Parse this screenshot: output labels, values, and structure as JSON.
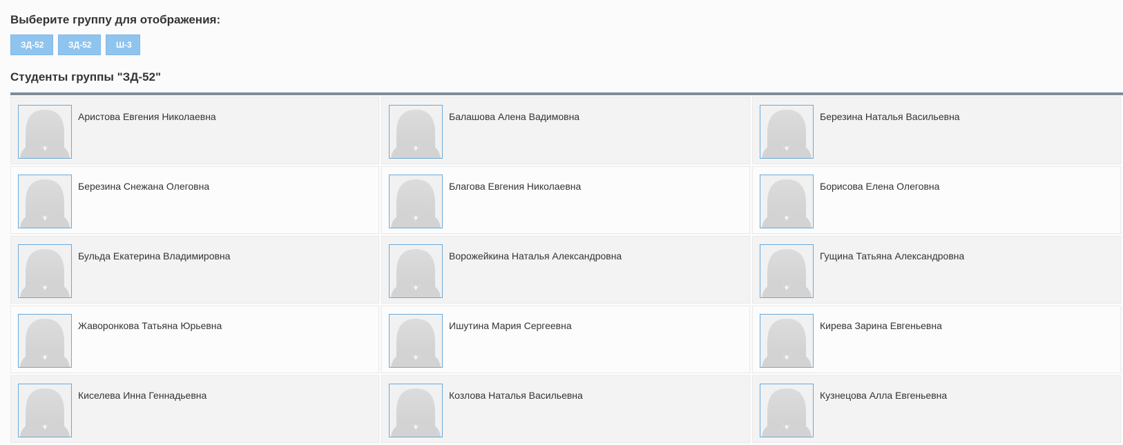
{
  "header": {
    "select_title": "Выберите группу для отображения:",
    "groups": [
      "ЗД-52",
      "ЗД-52",
      "Ш-3"
    ],
    "students_title": "Студенты группы \"ЗД-52\""
  },
  "students": [
    "Аристова Евгения Николаевна",
    "Балашова Алена Вадимовна",
    "Березина Наталья Васильевна",
    "Березина Снежана Олеговна",
    "Благова Евгения Николаевна",
    "Борисова Елена Олеговна",
    "Бульда Екатерина Владимировна",
    "Ворожейкина Наталья Александровна",
    "Гущина Татьяна Александровна",
    "Жаворонкова Татьяна Юрьевна",
    "Ишутина Мария Сергеевна",
    "Кирева Зарина Евгеньевна",
    "Киселева Инна Геннадьевна",
    "Козлова Наталья Васильевна",
    "Кузнецова Алла Евгеньевна"
  ],
  "avatar_icon": "female-silhouette-icon",
  "colors": {
    "button_bg": "#8fc4ef",
    "divider": "#7e8c99",
    "avatar_border": "#6aa8d8"
  }
}
